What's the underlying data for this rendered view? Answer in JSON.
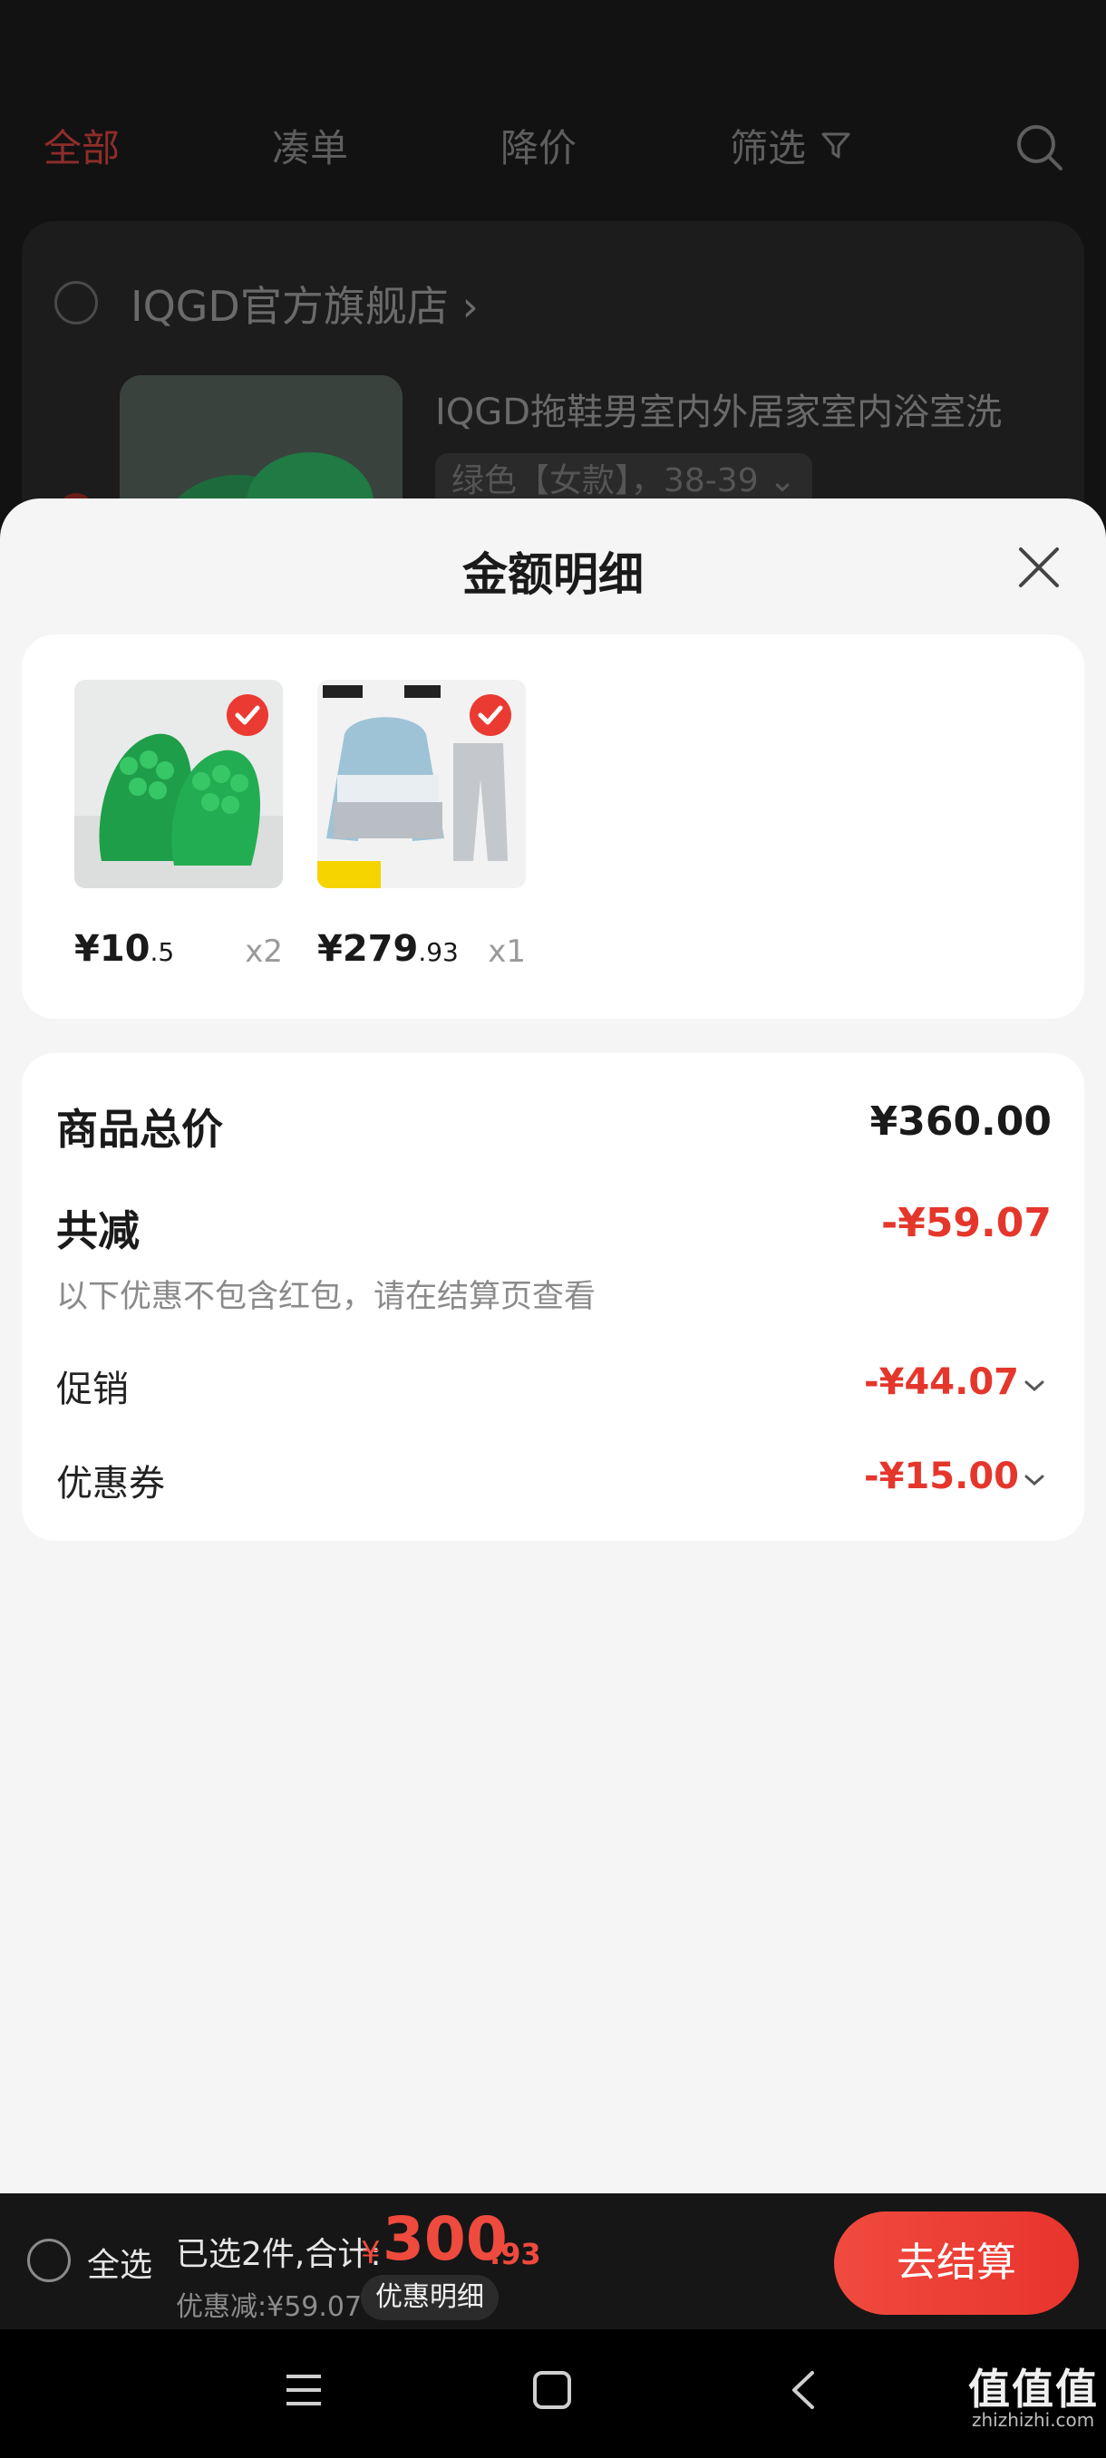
{
  "background": {
    "tabs": [
      {
        "label": "全部",
        "active": true
      },
      {
        "label": "凑单",
        "active": false
      },
      {
        "label": "降价",
        "active": false
      },
      {
        "label": "筛选",
        "active": false
      }
    ],
    "shop_name": "IQGD官方旗舰店 ›",
    "product_title": "IQGD拖鞋男室内外居家室内浴室洗",
    "product_variant": "绿色【女款】，38-39 ⌄"
  },
  "sheet": {
    "title": "金额明细",
    "items": [
      {
        "price_int": "¥10",
        "price_dec": ".5",
        "qty": "x2"
      },
      {
        "price_int": "¥279",
        "price_dec": ".93",
        "qty": "x1"
      }
    ],
    "summary": {
      "total_label": "商品总价",
      "total_value": "¥360.00",
      "discount_label": "共减",
      "discount_value": "-¥59.07",
      "note": "以下优惠不包含红包，请在结算页查看",
      "promo_label": "促销",
      "promo_value": "-¥44.07",
      "coupon_label": "优惠券",
      "coupon_value": "-¥15.00"
    }
  },
  "bottom_bar": {
    "select_all": "全选",
    "selected_text": "已选2件,合计:",
    "currency": "¥",
    "total_int": "300",
    "total_dec": ".93",
    "discount_text": "优惠减:¥59.07",
    "detail_button": "优惠明细",
    "checkout_button": "去结算"
  },
  "watermark": {
    "text": "值值值",
    "sub": "zhizhizhi.com"
  },
  "colors": {
    "accent_red": "#e5362c",
    "sheet_bg": "#f5f5f5"
  }
}
